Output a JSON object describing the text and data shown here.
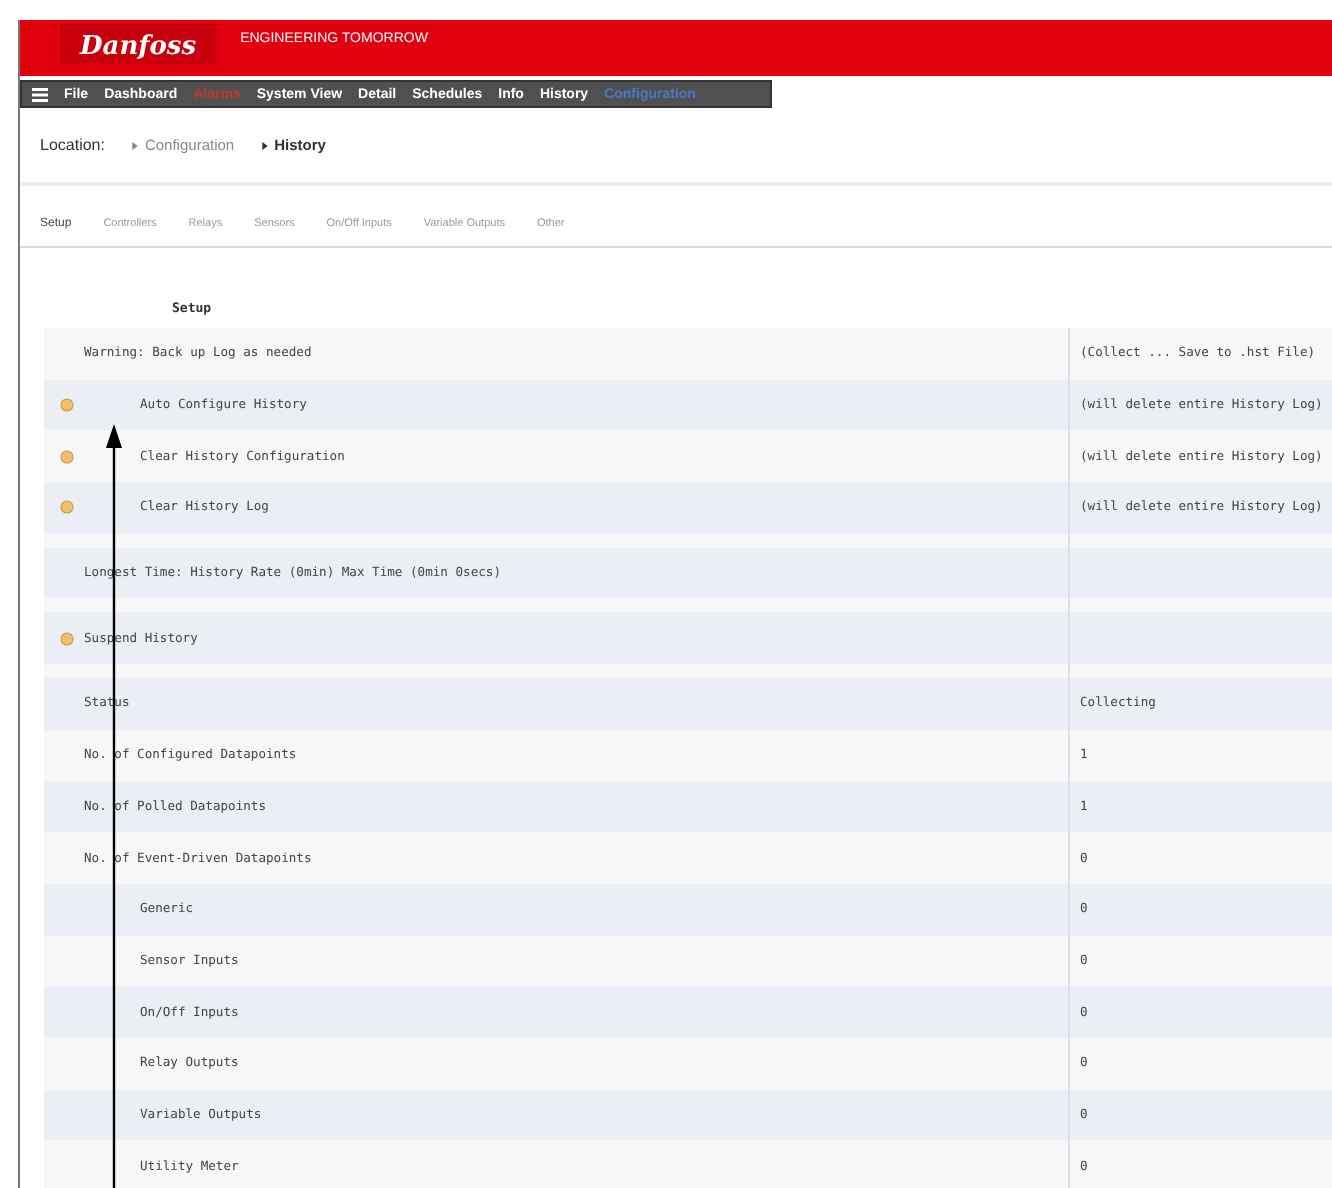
{
  "header": {
    "logo": "Danfoss",
    "tagline": "ENGINEERING TOMORROW"
  },
  "menu": [
    {
      "label": "File",
      "kind": "normal"
    },
    {
      "label": "Dashboard",
      "kind": "normal"
    },
    {
      "label": "Alarms",
      "kind": "alarm"
    },
    {
      "label": "System View",
      "kind": "normal"
    },
    {
      "label": "Detail",
      "kind": "normal"
    },
    {
      "label": "Schedules",
      "kind": "normal"
    },
    {
      "label": "Info",
      "kind": "normal"
    },
    {
      "label": "History",
      "kind": "normal"
    },
    {
      "label": "Configuration",
      "kind": "current"
    }
  ],
  "location": {
    "label": "Location:",
    "crumbs": [
      {
        "label": "Configuration",
        "selected": false
      },
      {
        "label": "History",
        "selected": true
      }
    ]
  },
  "tabs": [
    {
      "label": "Setup",
      "selected": true
    },
    {
      "label": "Controllers",
      "selected": false
    },
    {
      "label": "Relays",
      "selected": false
    },
    {
      "label": "Sensors",
      "selected": false
    },
    {
      "label": "On/Off Inputs",
      "selected": false
    },
    {
      "label": "Variable Outputs",
      "selected": false
    },
    {
      "label": "Other",
      "selected": false
    }
  ],
  "section_title": "Setup",
  "rows": [
    {
      "kind": "info",
      "label": "Warning: Back up Log as needed",
      "value": "(Collect ... Save to .hst File)"
    },
    {
      "kind": "action",
      "label": "Auto Configure History",
      "value": "(will delete entire History Log)"
    },
    {
      "kind": "action",
      "label": "Clear History Configuration",
      "value": "(will delete entire History Log)"
    },
    {
      "kind": "action",
      "label": "Clear History Log",
      "value": "(will delete entire History Log)"
    },
    {
      "kind": "spacer"
    },
    {
      "kind": "info",
      "label": "Longest Time: History Rate (0min) Max Time (0min 0secs)"
    },
    {
      "kind": "spacer"
    },
    {
      "kind": "switch",
      "label": "Suspend History"
    },
    {
      "kind": "spacer"
    },
    {
      "kind": "info",
      "label": "Status",
      "value": "Collecting"
    },
    {
      "kind": "info",
      "label": "No. of Configured Datapoints",
      "value": "1"
    },
    {
      "kind": "info",
      "label": "No. of Polled Datapoints",
      "value": "1"
    },
    {
      "kind": "info",
      "label": "No. of Event-Driven Datapoints",
      "value": "0",
      "children": [
        {
          "kind": "info",
          "label": "Generic",
          "value": "0"
        },
        {
          "kind": "info",
          "label": "Sensor Inputs",
          "value": "0"
        },
        {
          "kind": "info",
          "label": "On/Off Inputs",
          "value": "0"
        },
        {
          "kind": "info",
          "label": "Relay Outputs",
          "value": "0"
        },
        {
          "kind": "info",
          "label": "Variable Outputs",
          "value": "0"
        },
        {
          "kind": "info",
          "label": "Utility Meter",
          "value": "0"
        }
      ]
    }
  ]
}
